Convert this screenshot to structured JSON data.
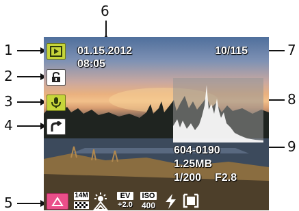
{
  "callouts": {
    "n1": "1",
    "n2": "2",
    "n3": "3",
    "n4": "4",
    "n5": "5",
    "n6": "6",
    "n7": "7",
    "n8": "8",
    "n9": "9"
  },
  "overlay": {
    "date": "01.15.2012",
    "time": "08:05",
    "counter": "10/115",
    "file_number": "604-0190",
    "file_size": "1.25MB",
    "shutter": "1/200",
    "aperture": "F2.8"
  },
  "status_icons": {
    "resolution": "14M",
    "ev_label": "EV",
    "ev_value": "+2.0",
    "iso_label": "ISO",
    "iso_value": "400"
  },
  "icons": [
    "playback-mode-icon",
    "protect-lock-icon",
    "voice-memo-icon",
    "share-icon",
    "face-capture-icon",
    "resolution-icon",
    "white-balance-daylight-icon",
    "exposure-compensation-icon",
    "iso-icon",
    "flash-icon",
    "focus-frame-icon"
  ],
  "colors": {
    "playback_icon_bg": "#c6d53a",
    "protect_icon_bg": "#ffffff",
    "voice_icon_bg": "#c6d53a",
    "share_icon_bg": "#ffffff",
    "face_icon_bg": "#ea4f8a"
  }
}
